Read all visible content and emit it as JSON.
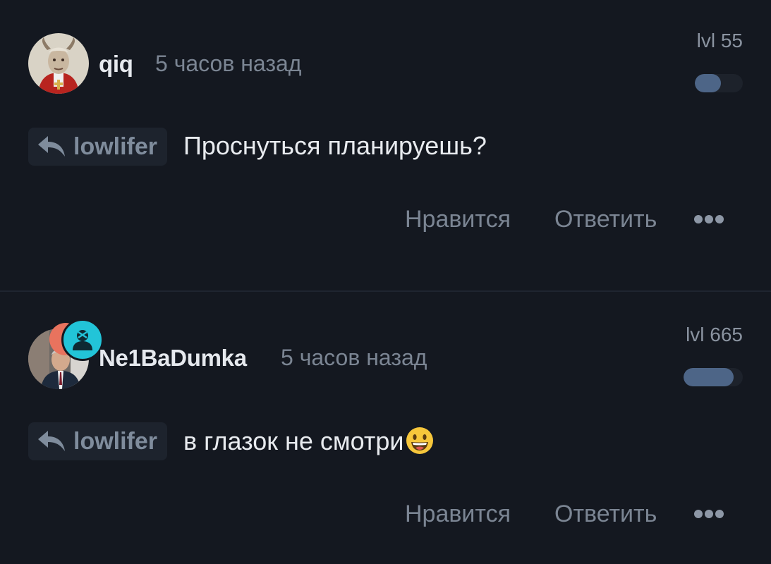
{
  "comments": [
    {
      "username": "qiq",
      "time": "5 часов назад",
      "level_label": "lvl 55",
      "level_progress": 0.55,
      "reply_to": "lowlifer",
      "text": "Проснуться планируешь?",
      "emoji": "",
      "actions": {
        "like": "Нравится",
        "reply": "Ответить"
      }
    },
    {
      "username": "Ne1BaDumka",
      "time": "5 часов назад",
      "level_label": "lvl 665",
      "level_progress": 0.85,
      "reply_to": "lowlifer",
      "text": "в глазок не смотри",
      "emoji": "grinning-face-emoji",
      "actions": {
        "like": "Нравится",
        "reply": "Ответить"
      }
    }
  ],
  "colors": {
    "background": "#141820",
    "level_fill": "#4d6587",
    "badge": "#22c4d8"
  },
  "icons": {
    "reply": "reply-arrow-icon",
    "more": "more-dots-icon",
    "badge": "user-badge-icon"
  }
}
